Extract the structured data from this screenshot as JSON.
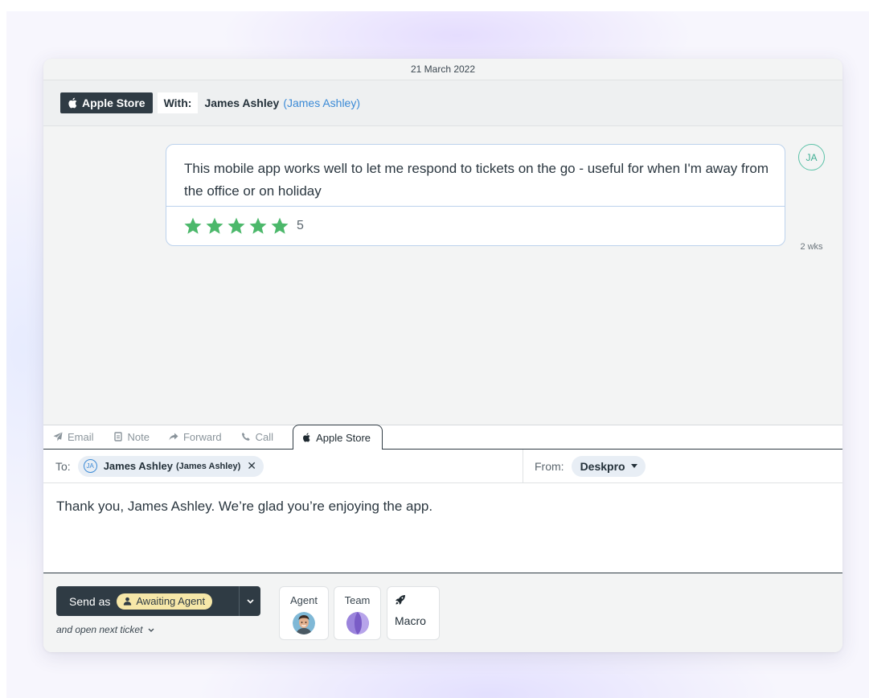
{
  "conversation": {
    "date": "21 March 2022",
    "channel": "Apple Store",
    "with_label": "With:",
    "customer_name": "James Ashley",
    "customer_alias": "(James Ashley)",
    "message": {
      "text": "This mobile app works well to let me respond to tickets on the go - useful for when I'm away from the office or on holiday",
      "rating": 5,
      "rating_label": "5",
      "author_initials": "JA",
      "age": "2 wks"
    }
  },
  "composer": {
    "tabs": [
      {
        "label": "Email",
        "icon": "send-icon"
      },
      {
        "label": "Note",
        "icon": "note-icon"
      },
      {
        "label": "Forward",
        "icon": "forward-icon"
      },
      {
        "label": "Call",
        "icon": "phone-icon"
      },
      {
        "label": "Apple Store",
        "icon": "apple-icon",
        "active": true
      }
    ],
    "to_label": "To:",
    "recipient": {
      "initials": "JA",
      "name": "James Ashley",
      "alias": "(James Ashley)"
    },
    "from_label": "From:",
    "from_value": "Deskpro",
    "body": "Thank you, James Ashley. We’re glad you’re enjoying the app."
  },
  "footer": {
    "send_label": "Send as",
    "status": "Awaiting Agent",
    "open_next": "and open next ticket",
    "agent_label": "Agent",
    "team_label": "Team",
    "macro_label": "Macro"
  },
  "colors": {
    "accent_dark": "#2f3b44",
    "link_blue": "#3b8ad6",
    "star_green": "#4cb86b",
    "status_yellow": "#f6e7a8",
    "avatar_teal": "#5cc2a8"
  }
}
